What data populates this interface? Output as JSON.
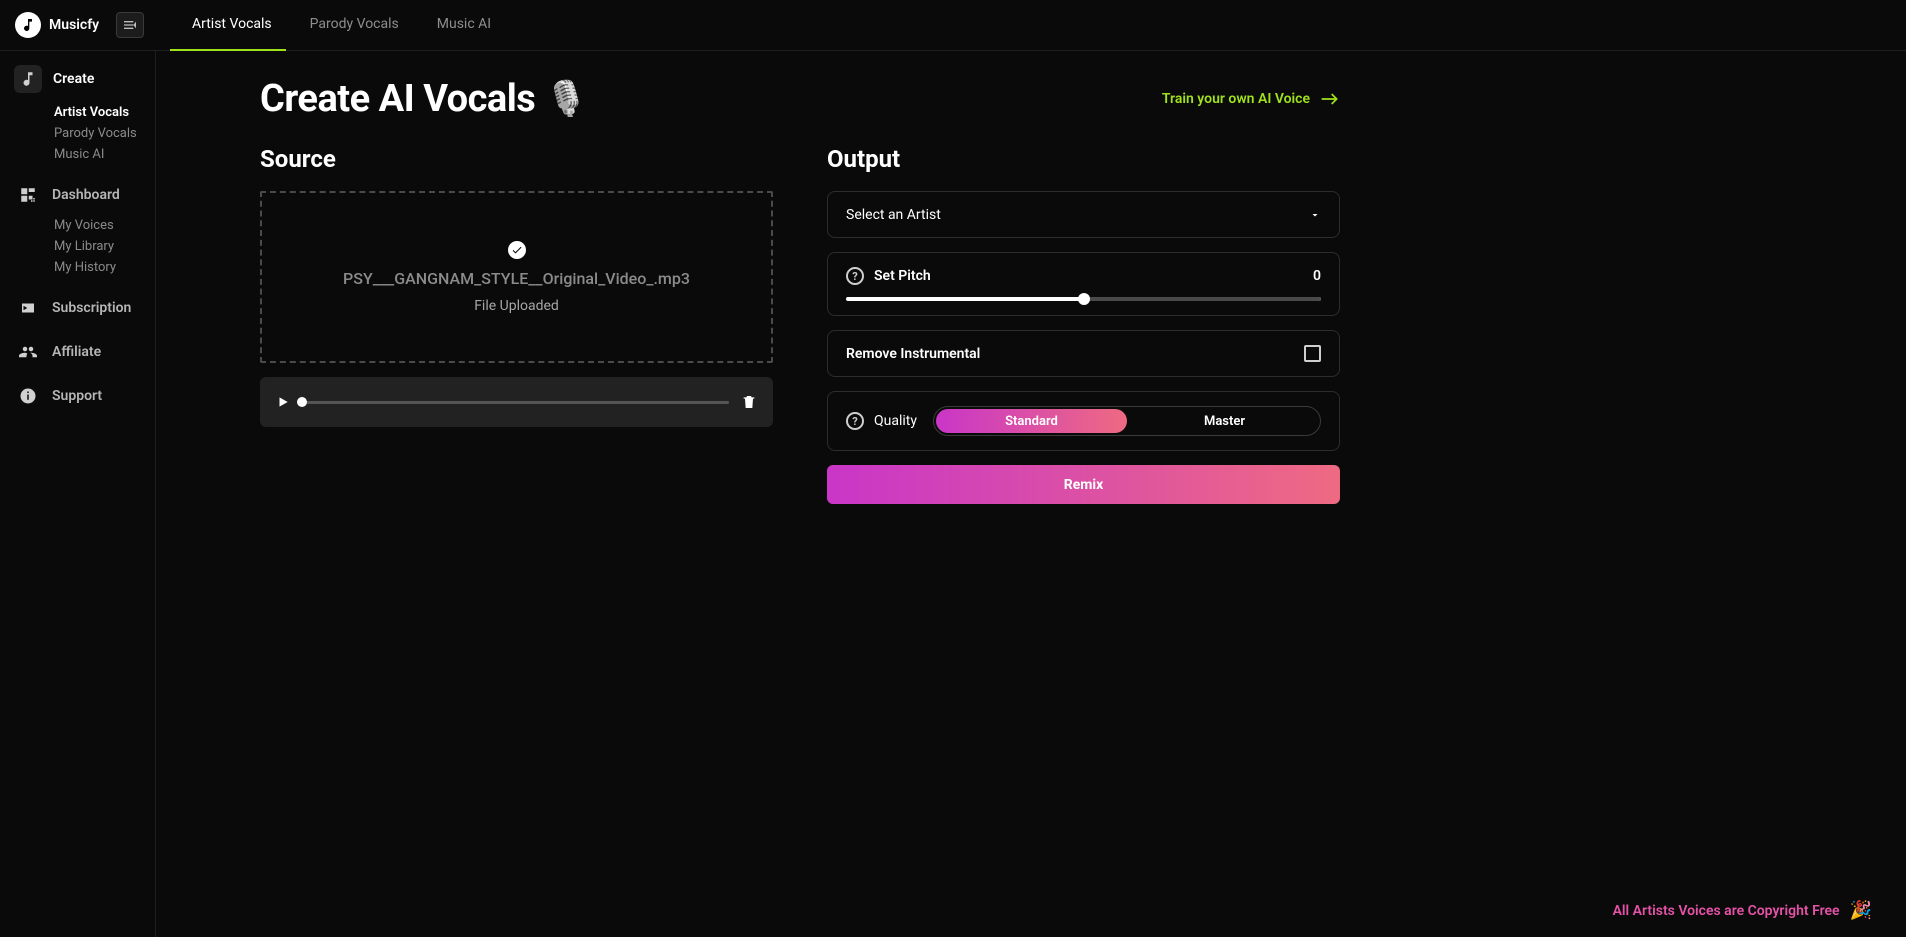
{
  "brand": "Musicfy",
  "topTabs": [
    "Artist Vocals",
    "Parody Vocals",
    "Music AI"
  ],
  "activeTopTab": 0,
  "sidebar": {
    "create": {
      "title": "Create",
      "items": [
        "Artist Vocals",
        "Parody Vocals",
        "Music AI"
      ],
      "activeIndex": 0
    },
    "dashboard": {
      "title": "Dashboard",
      "items": [
        "My Voices",
        "My Library",
        "My History"
      ]
    },
    "subscription": "Subscription",
    "affiliate": "Affiliate",
    "support": "Support"
  },
  "page": {
    "title": "Create AI Vocals",
    "trainLink": "Train your own AI Voice",
    "sourceHeading": "Source",
    "outputHeading": "Output",
    "uploadedFile": "PSY___GANGNAM_STYLE__Original_Video_.mp3",
    "fileStatus": "File Uploaded",
    "selectArtist": "Select an Artist",
    "setPitch": "Set Pitch",
    "pitchValue": "0",
    "removeInstrumental": "Remove Instrumental",
    "quality": "Quality",
    "qualityOptions": [
      "Standard",
      "Master"
    ],
    "remix": "Remix",
    "copyrightNote": "All Artists Voices are Copyright Free"
  }
}
